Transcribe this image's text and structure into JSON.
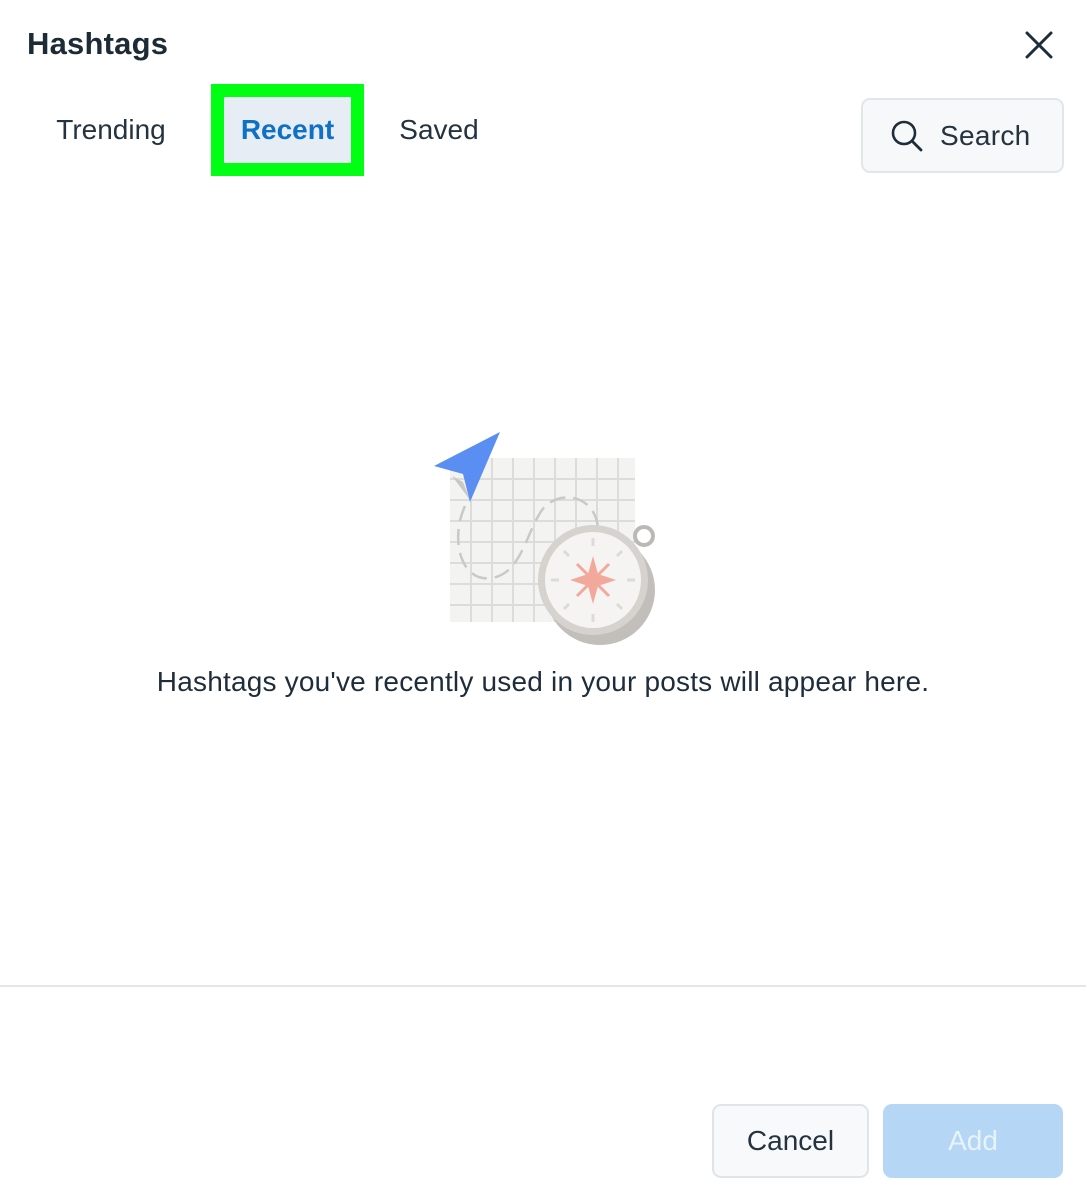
{
  "dialog": {
    "title": "Hashtags",
    "close_icon": "close-icon"
  },
  "tabs": [
    {
      "label": "Trending",
      "selected": false
    },
    {
      "label": "Recent",
      "selected": true
    },
    {
      "label": "Saved",
      "selected": false
    }
  ],
  "search": {
    "label": "Search",
    "icon": "search-icon"
  },
  "empty_state": {
    "illustration": "map-compass-illustration",
    "message": "Hashtags you've recently used in your posts will appear here."
  },
  "footer": {
    "cancel_label": "Cancel",
    "add_label": "Add",
    "add_disabled": true
  },
  "colors": {
    "selected_tab_text": "#1070c4",
    "selected_tab_highlight": "#00ff12",
    "add_button_disabled": "#b5d6f4",
    "arrow_blue": "#5b8ef2"
  }
}
